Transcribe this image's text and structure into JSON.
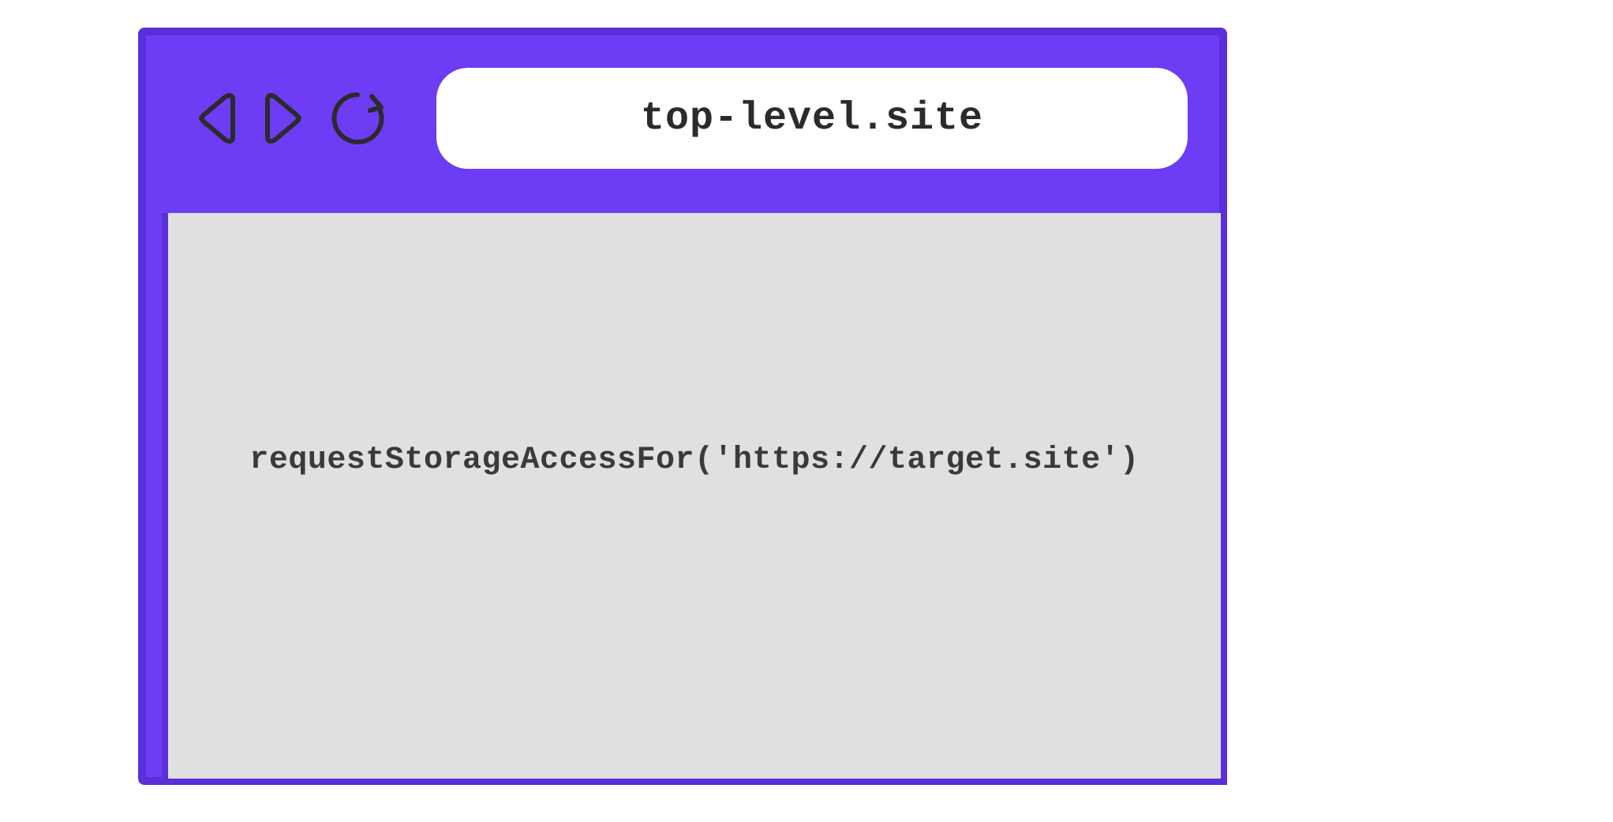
{
  "colors": {
    "window_bg": "#6c3df4",
    "window_border": "#5a2fd9",
    "content_bg": "#e0e0e0",
    "address_bg": "#ffffff",
    "text_dark": "#2b2b2b",
    "icon_stroke": "#2b2b2b"
  },
  "address_bar": {
    "url": "top-level.site"
  },
  "content": {
    "code": "requestStorageAccessFor('https://target.site')"
  },
  "icons": {
    "back": "back-icon",
    "forward": "forward-icon",
    "reload": "reload-icon"
  }
}
